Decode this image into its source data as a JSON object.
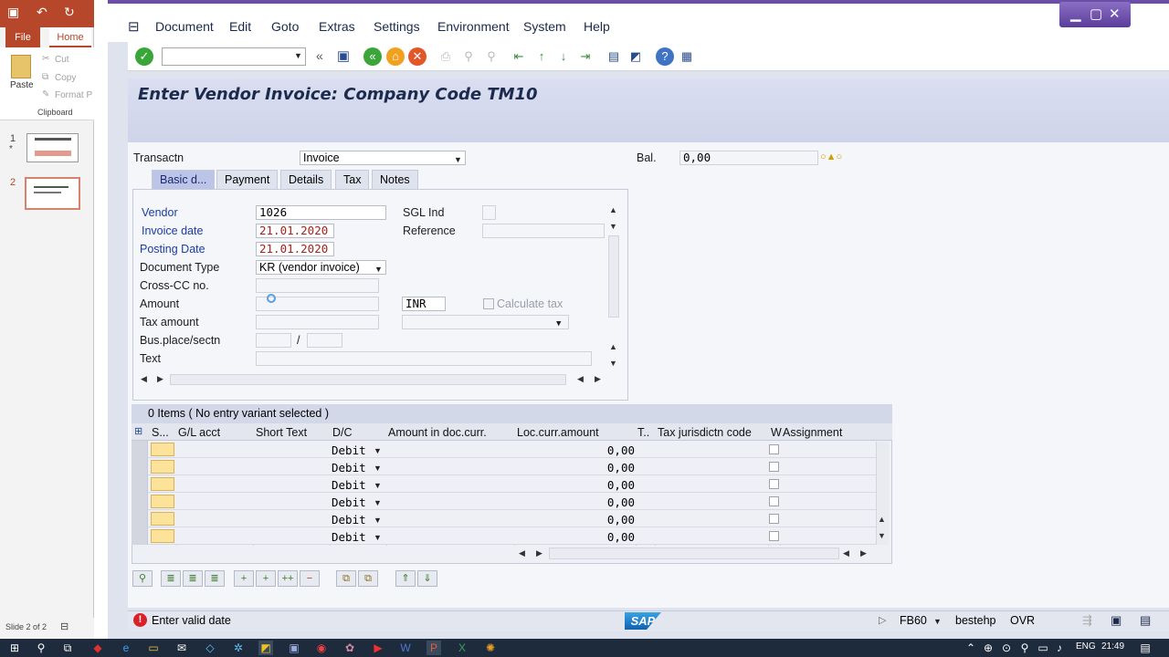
{
  "ppt": {
    "tab_file": "File",
    "tab_home": "Home",
    "cut": "Cut",
    "copy": "Copy",
    "format_painter": "Format P",
    "paste": "Paste",
    "clipboard": "Clipboard",
    "slide1": "1",
    "slide2": "2",
    "status": "Slide 2 of 2"
  },
  "sap": {
    "menu": [
      "Document",
      "Edit",
      "Goto",
      "Extras",
      "Settings",
      "Environment",
      "System",
      "Help"
    ],
    "title": "Enter Vendor Invoice: Company Code TM10",
    "transaction_label": "Transactn",
    "transaction_value": "Invoice",
    "balance_label": "Bal.",
    "balance_value": "0,00",
    "tabs": [
      "Basic d...",
      "Payment",
      "Details",
      "Tax",
      "Notes"
    ],
    "form": {
      "vendor_label": "Vendor",
      "vendor_value": "1026",
      "invoice_date_label": "Invoice date",
      "invoice_date_value": "21.01.2020",
      "posting_date_label": "Posting Date",
      "posting_date_value": "21.01.2020",
      "doc_type_label": "Document Type",
      "doc_type_value": "KR (vendor invoice)",
      "cross_cc_label": "Cross-CC no.",
      "amount_label": "Amount",
      "currency_value": "INR",
      "calc_tax_label": "Calculate tax",
      "tax_amount_label": "Tax amount",
      "bus_place_label": "Bus.place/sectn",
      "slash": "/",
      "text_label": "Text",
      "sgl_label": "SGL Ind",
      "reference_label": "Reference"
    },
    "items": {
      "caption": "0 Items ( No entry variant selected )",
      "headers": [
        "S...",
        "G/L acct",
        "Short Text",
        "D/C",
        "Amount in doc.curr.",
        "Loc.curr.amount",
        "T..",
        "Tax jurisdictn code",
        "W",
        "Assignment"
      ],
      "rows": [
        {
          "dc": "Debit",
          "amount": "0,00"
        },
        {
          "dc": "Debit",
          "amount": "0,00"
        },
        {
          "dc": "Debit",
          "amount": "0,00"
        },
        {
          "dc": "Debit",
          "amount": "0,00"
        },
        {
          "dc": "Debit",
          "amount": "0,00"
        },
        {
          "dc": "Debit",
          "amount": "0,00"
        }
      ]
    },
    "status_message": "Enter valid date",
    "status_tcode": "FB60",
    "status_server": "bestehp",
    "status_mode": "OVR",
    "sap_logo": "SAP"
  },
  "taskbar": {
    "lang": "ENG",
    "time": "21:49"
  },
  "colors": {
    "required_label": "#1a3da3",
    "error": "#d8222a",
    "title_band": "#cfd4ea"
  }
}
